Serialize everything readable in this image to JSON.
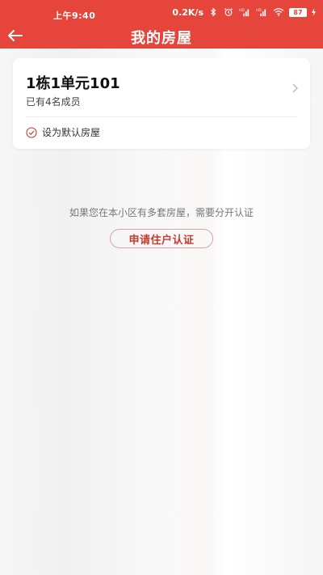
{
  "status_bar": {
    "time": "上午9:40",
    "net_speed": "0.2K/s",
    "battery_level": "87",
    "icons": [
      "bluetooth-icon",
      "alarm-icon",
      "signal-hd-icon",
      "signal-hd-icon",
      "wifi-icon",
      "battery-icon",
      "charging-icon"
    ]
  },
  "app_bar": {
    "title": "我的房屋",
    "back_icon": "arrow-left-icon"
  },
  "house_card": {
    "name": "1栋1单元101",
    "members": "已有4名成员",
    "chevron_icon": "chevron-right-icon",
    "default_option": {
      "icon": "check-circle-icon",
      "label": "设为默认房屋",
      "checked": true
    }
  },
  "hint_text": "如果您在本小区有多套房屋，需要分开认证",
  "apply_button": {
    "label": "申请住户认证"
  },
  "colors": {
    "header": "#e5453b",
    "accent_text": "#c53b31",
    "button_border": "#d8a4a0",
    "background": "#f6f5f5"
  }
}
